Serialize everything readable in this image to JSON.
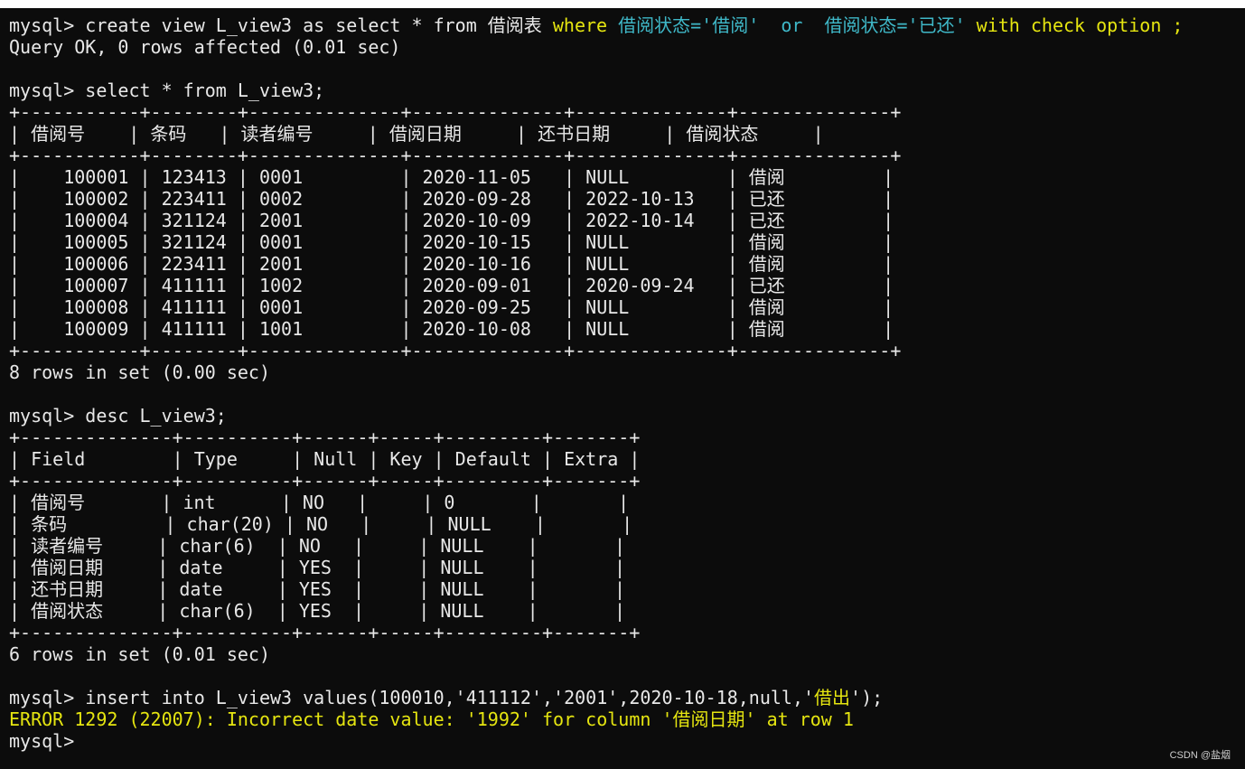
{
  "colors": {
    "background": "#0c0c0c",
    "text": "#e8e8e8",
    "keyword": "#e5e510",
    "string": "#3fb8c8",
    "error": "#e5e510"
  },
  "lines": [
    [
      {
        "t": "mysql> create view L_view3 as select * from 借阅表 ",
        "c": "default"
      },
      {
        "t": "where ",
        "c": "keyword"
      },
      {
        "t": "借阅状态='借阅'  ",
        "c": "string"
      },
      {
        "t": "or  ",
        "c": "string"
      },
      {
        "t": "借阅状态='已还' ",
        "c": "string"
      },
      {
        "t": "with check option ;",
        "c": "keyword"
      }
    ],
    [
      {
        "t": "Query OK, 0 rows affected (0.01 sec)",
        "c": "default"
      }
    ],
    [],
    [
      {
        "t": "mysql> select * from L_view3;",
        "c": "default"
      }
    ],
    [
      {
        "t": "+-----------+--------+--------------+--------------+--------------+--------------+",
        "c": "default"
      }
    ],
    [
      {
        "t": "| 借阅号    | 条码   | 读者编号     | 借阅日期     | 还书日期     | 借阅状态     |",
        "c": "default"
      }
    ],
    [
      {
        "t": "+-----------+--------+--------------+--------------+--------------+--------------+",
        "c": "default"
      }
    ],
    [
      {
        "t": "|    100001 | 123413 | 0001         | 2020-11-05   | NULL         | 借阅         |",
        "c": "default"
      }
    ],
    [
      {
        "t": "|    100002 | 223411 | 0002         | 2020-09-28   | 2022-10-13   | 已还         |",
        "c": "default"
      }
    ],
    [
      {
        "t": "|    100004 | 321124 | 2001         | 2020-10-09   | 2022-10-14   | 已还         |",
        "c": "default"
      }
    ],
    [
      {
        "t": "|    100005 | 321124 | 0001         | 2020-10-15   | NULL         | 借阅         |",
        "c": "default"
      }
    ],
    [
      {
        "t": "|    100006 | 223411 | 2001         | 2020-10-16   | NULL         | 借阅         |",
        "c": "default"
      }
    ],
    [
      {
        "t": "|    100007 | 411111 | 1002         | 2020-09-01   | 2020-09-24   | 已还         |",
        "c": "default"
      }
    ],
    [
      {
        "t": "|    100008 | 411111 | 0001         | 2020-09-25   | NULL         | 借阅         |",
        "c": "default"
      }
    ],
    [
      {
        "t": "|    100009 | 411111 | 1001         | 2020-10-08   | NULL         | 借阅         |",
        "c": "default"
      }
    ],
    [
      {
        "t": "+-----------+--------+--------------+--------------+--------------+--------------+",
        "c": "default"
      }
    ],
    [
      {
        "t": "8 rows in set (0.00 sec)",
        "c": "default"
      }
    ],
    [],
    [
      {
        "t": "mysql> desc L_view3;",
        "c": "default"
      }
    ],
    [
      {
        "t": "+--------------+----------+------+-----+---------+-------+",
        "c": "default"
      }
    ],
    [
      {
        "t": "| Field        | Type     | Null | Key | Default | Extra |",
        "c": "default"
      }
    ],
    [
      {
        "t": "+--------------+----------+------+-----+---------+-------+",
        "c": "default"
      }
    ],
    [
      {
        "t": "| 借阅号       | int      | NO   |     | 0       |       |",
        "c": "default"
      }
    ],
    [
      {
        "t": "| 条码         | char(20) | NO   |     | NULL    |       |",
        "c": "default"
      }
    ],
    [
      {
        "t": "| 读者编号     | char(6)  | NO   |     | NULL    |       |",
        "c": "default"
      }
    ],
    [
      {
        "t": "| 借阅日期     | date     | YES  |     | NULL    |       |",
        "c": "default"
      }
    ],
    [
      {
        "t": "| 还书日期     | date     | YES  |     | NULL    |       |",
        "c": "default"
      }
    ],
    [
      {
        "t": "| 借阅状态     | char(6)  | YES  |     | NULL    |       |",
        "c": "default"
      }
    ],
    [
      {
        "t": "+--------------+----------+------+-----+---------+-------+",
        "c": "default"
      }
    ],
    [
      {
        "t": "6 rows in set (0.01 sec)",
        "c": "default"
      }
    ],
    [],
    [
      {
        "t": "mysql> insert into L_view3 values(100010,'411112','2001',2020-10-18,null,'",
        "c": "default"
      },
      {
        "t": "借出",
        "c": "keyword"
      },
      {
        "t": "');",
        "c": "default"
      }
    ],
    [
      {
        "t": "ERROR 1292 (22007): Incorrect date value: '1992' for column '借阅日期' at row 1",
        "c": "error"
      }
    ],
    [
      {
        "t": "mysql> ",
        "c": "default"
      }
    ]
  ],
  "watermark": "CSDN @盐烟"
}
